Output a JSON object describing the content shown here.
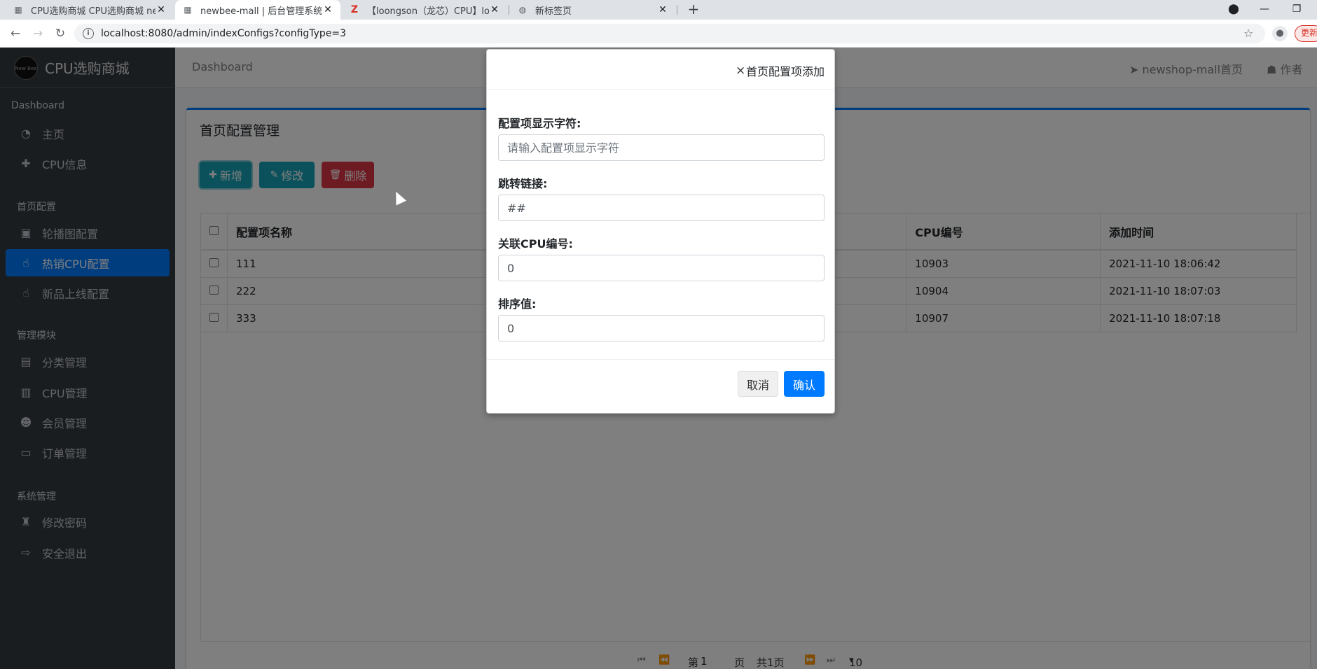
{
  "browser": {
    "tabs": [
      {
        "title": "CPU选购商城 CPU选购商城 newbee",
        "favicon": "grid-icon"
      },
      {
        "title": "newbee-mall | 后台管理系统",
        "favicon": "grid-icon"
      },
      {
        "title": "【loongson（龙芯）CPU】loon",
        "favicon": "z-icon"
      },
      {
        "title": "新标签页",
        "favicon": "globe-icon"
      }
    ],
    "url": "localhost:8080/admin/indexConfigs?configType=3",
    "update_label": "更新"
  },
  "sidebar": {
    "brand": "CPU选购商城",
    "logo_text": "New Bee",
    "sections": [
      {
        "header": "Dashboard",
        "items": [
          {
            "label": "主页",
            "icon": "dashboard-icon"
          },
          {
            "label": "CPU信息",
            "icon": "plus-icon"
          }
        ]
      },
      {
        "header": "首页配置",
        "items": [
          {
            "label": "轮播图配置",
            "icon": "image-icon"
          },
          {
            "label": "热销CPU配置",
            "icon": "hand-pointer-icon",
            "active": true
          },
          {
            "label": "新品上线配置",
            "icon": "hand-pointer-icon"
          }
        ]
      },
      {
        "header": "管理模块",
        "items": [
          {
            "label": "分类管理",
            "icon": "list-icon"
          },
          {
            "label": "CPU管理",
            "icon": "archive-icon"
          },
          {
            "label": "会员管理",
            "icon": "users-icon"
          },
          {
            "label": "订单管理",
            "icon": "money-icon"
          }
        ]
      },
      {
        "header": "系统管理",
        "items": [
          {
            "label": "修改密码",
            "icon": "user-secret-icon"
          },
          {
            "label": "安全退出",
            "icon": "sign-out-icon"
          }
        ]
      }
    ]
  },
  "header": {
    "breadcrumb": "Dashboard",
    "home_link": "newshop-mall首页",
    "author_link": "作者"
  },
  "card": {
    "title": "首页配置管理",
    "buttons": {
      "add": "新增",
      "edit": "修改",
      "delete": "删除"
    }
  },
  "table": {
    "columns": {
      "name": "配置项名称",
      "cpu_id": "CPU编号",
      "added": "添加时间"
    },
    "rows": [
      {
        "name": "111",
        "cpu_id": "10903",
        "added": "2021-11-10 18:06:42"
      },
      {
        "name": "222",
        "cpu_id": "10904",
        "added": "2021-11-10 18:07:03"
      },
      {
        "name": "333",
        "cpu_id": "10907",
        "added": "2021-11-10 18:07:18"
      }
    ]
  },
  "pager": {
    "page_prefix": "第",
    "page_value": "1",
    "page_suffix": "页",
    "total": "共1页",
    "page_size": "10"
  },
  "modal": {
    "title": "首页配置项添加",
    "fields": {
      "name_label": "配置项显示字符:",
      "name_placeholder": "请输入配置项显示字符",
      "link_label": "跳转链接:",
      "link_value": "##",
      "cpu_label": "关联CPU编号:",
      "cpu_value": "0",
      "rank_label": "排序值:",
      "rank_value": "0"
    },
    "cancel": "取消",
    "confirm": "确认"
  }
}
